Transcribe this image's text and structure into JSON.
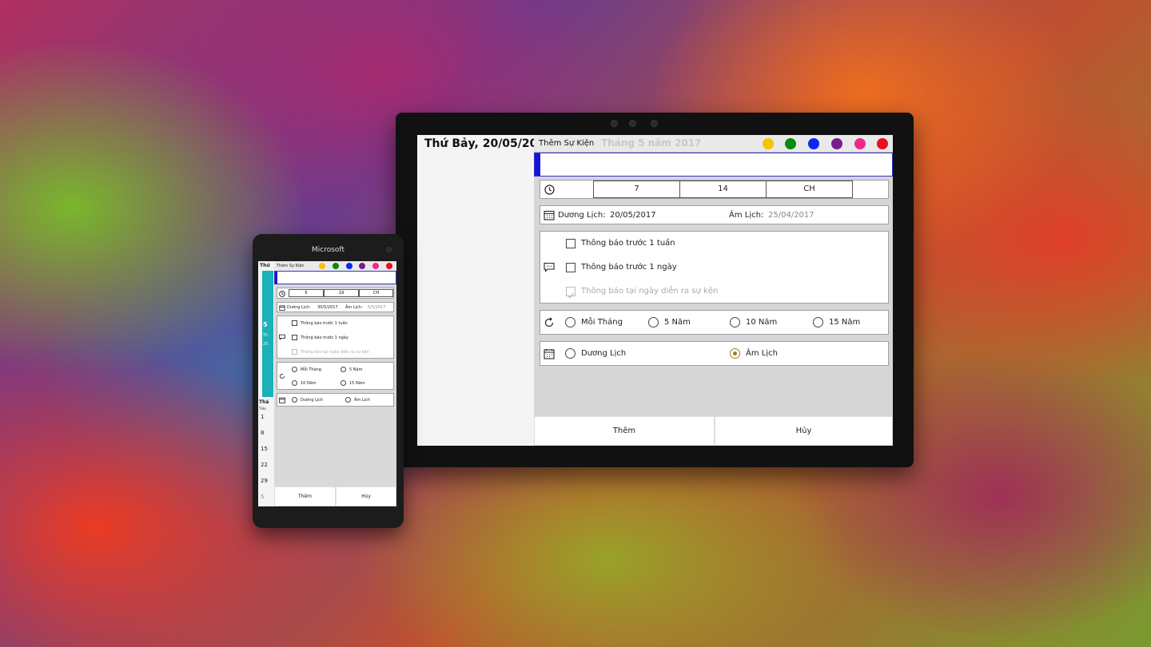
{
  "colors": {
    "palette": [
      "#f5c400",
      "#0a8a0a",
      "#0a28f0",
      "#7a1b8e",
      "#f0288c",
      "#e8101a"
    ],
    "accent_bar": "#1414d8",
    "teal": "#1ab1b8",
    "radio_selected": "#a8782c"
  },
  "tablet": {
    "date_title": "Thứ Bảy, 20/05/2017",
    "header": {
      "title": "Thêm Sự Kiện",
      "ghost_title": "Tháng 5 năm 2017"
    },
    "time": {
      "icon": "clock-icon",
      "hour": "7",
      "minute": "14",
      "period": "CH"
    },
    "calendar": {
      "icon": "calendar-icon",
      "solar_label": "Dương Lịch:",
      "solar_value": "20/05/2017",
      "lunar_label": "Âm Lịch:",
      "lunar_value": "25/04/2017"
    },
    "notifications": {
      "icon": "message-icon",
      "items": [
        {
          "label": "Thông báo trước 1 tuần",
          "checked": false,
          "disabled": false
        },
        {
          "label": "Thông báo trước 1 ngày",
          "checked": false,
          "disabled": false
        },
        {
          "label": "Thông báo tại ngày diễn ra sự kện",
          "checked": true,
          "disabled": true
        }
      ]
    },
    "repeat": {
      "icon": "repeat-icon",
      "options": [
        "Mỗi Tháng",
        "5 Năm",
        "10 Năm",
        "15 Năm"
      ]
    },
    "calendar_type": {
      "icon": "calendar-type-icon",
      "options": [
        "Dương Lịch",
        "Âm Lịch"
      ],
      "selected": "Âm Lịch"
    },
    "buttons": {
      "add": "Thêm",
      "cancel": "Hủy"
    }
  },
  "phone": {
    "brand": "Microsoft",
    "header_title": "Thêm Sự Kiện",
    "left_partial_title": "Thứ",
    "time": {
      "hour": "5",
      "minute": "19",
      "period": "CH"
    },
    "calendar": {
      "solar_label": "Dương Lịch:",
      "solar_value": "30/5/2017",
      "lunar_label": "Âm Lịch:",
      "lunar_value": "5/5/2017"
    },
    "notifications": [
      "Thông báo trước 1 tuần",
      "Thông báo trước 1 ngày",
      "Thông báo tại ngày diễn ra sự kện"
    ],
    "repeat": [
      "Mỗi Tháng",
      "5 Năm",
      "10 Năm",
      "15 Năm"
    ],
    "calendar_type": [
      "Dương Lịch",
      "Âm Lịch"
    ],
    "teal_number": "5",
    "teal_sub": "Th",
    "teal_year_partial": "20",
    "left_week_title": "Thá",
    "left_week_sub": "T.Ha",
    "left_days": [
      "1",
      "8",
      "15",
      "22",
      "29",
      "5"
    ],
    "buttons": {
      "add": "Thêm",
      "cancel": "Hủy"
    }
  }
}
